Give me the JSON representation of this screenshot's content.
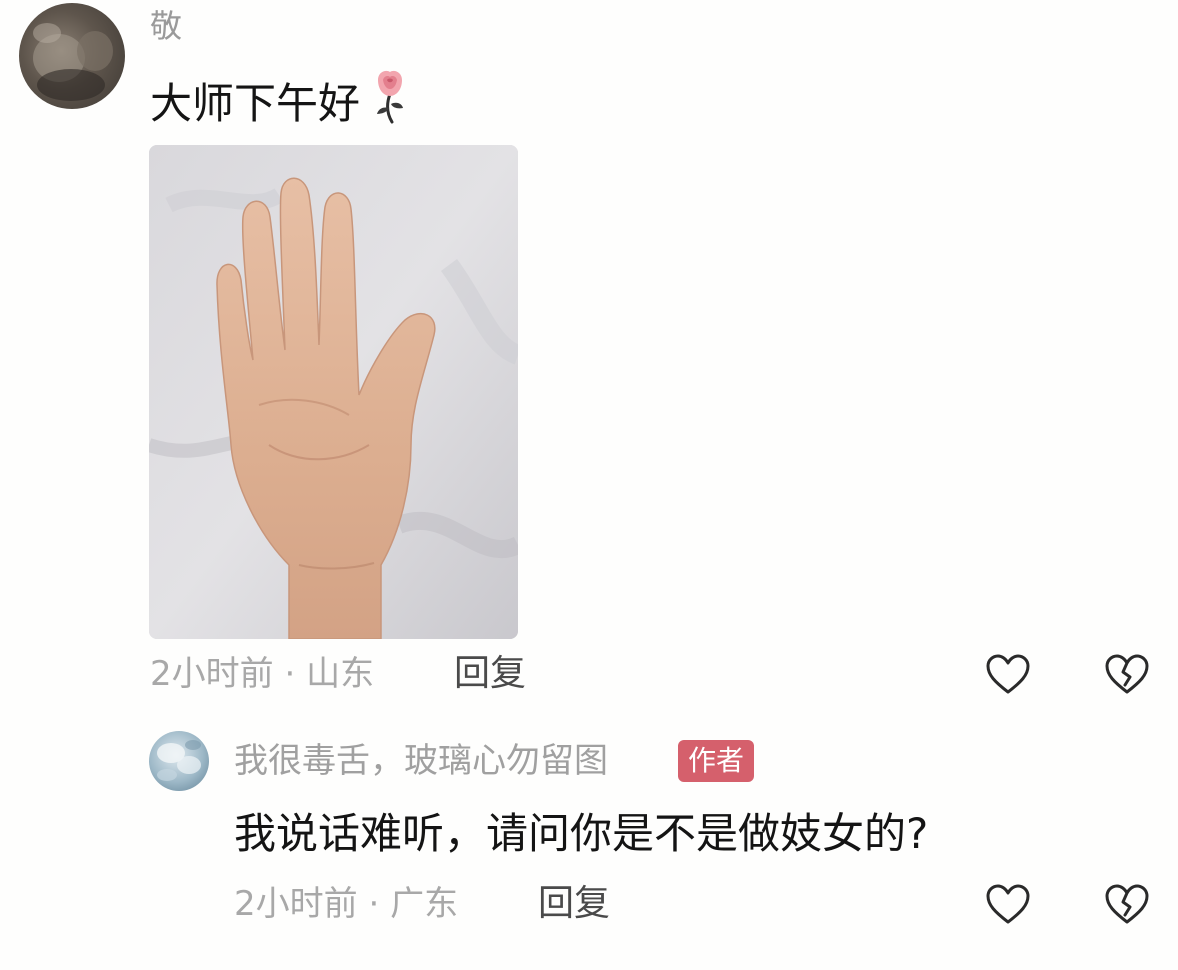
{
  "comments": [
    {
      "username": "敬",
      "text": "大师下午好",
      "emoji": "rose-icon",
      "has_image": true,
      "image_description_icon": "palm-photo",
      "time": "2小时前",
      "location": "山东",
      "separator": "·",
      "reply_label": "回复"
    },
    {
      "username": "我很毒舌，玻璃心勿留图",
      "badge": "作者",
      "text": "我说话难听，请问你是不是做妓女的?",
      "time": "2小时前",
      "location": "广东",
      "separator": "·",
      "reply_label": "回复"
    }
  ],
  "colors": {
    "badge_bg": "#d5606c",
    "meta_text": "#a8a8a8",
    "username_text": "#9a9a9a",
    "body_text": "#141414"
  },
  "icons": {
    "like": "heart-outline-icon",
    "dislike": "broken-heart-outline-icon"
  }
}
